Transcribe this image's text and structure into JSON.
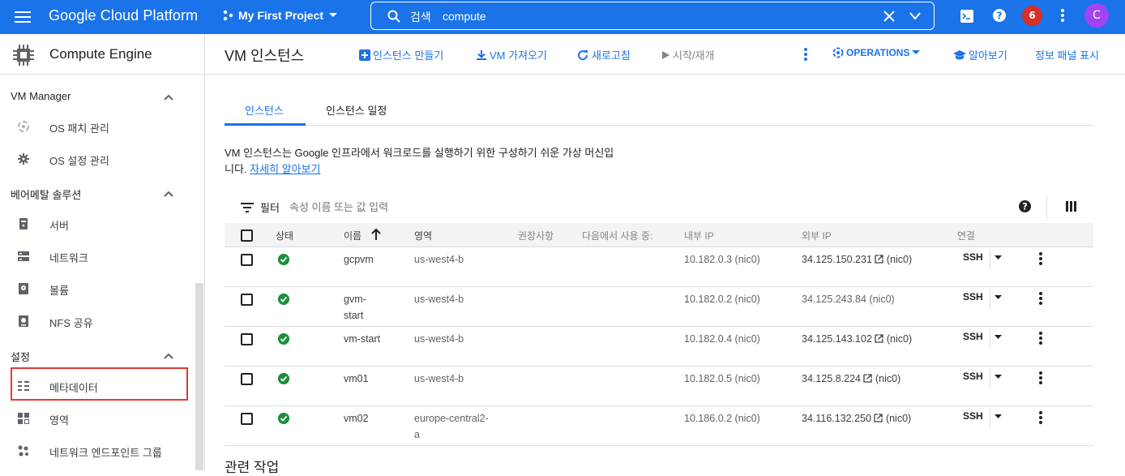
{
  "topbar": {
    "brand": "Google Cloud Platform",
    "project": "My First Project",
    "search_label": "검색",
    "search_value": "compute",
    "notification_count": "6",
    "avatar_letter": "C"
  },
  "sidebar": {
    "title": "Compute Engine",
    "sections": [
      {
        "label": "VM Manager",
        "items": [
          {
            "label": "OS 패치 관리"
          },
          {
            "label": "OS 설정 관리"
          }
        ]
      },
      {
        "label": "베어메탈 솔루션",
        "items": [
          {
            "label": "서버"
          },
          {
            "label": "네트워크"
          },
          {
            "label": "볼륨"
          },
          {
            "label": "NFS 공유"
          }
        ]
      },
      {
        "label": "설정",
        "items": [
          {
            "label": "메타데이터"
          },
          {
            "label": "영역"
          },
          {
            "label": "네트워크 엔드포인트 그룹"
          }
        ]
      }
    ]
  },
  "main": {
    "title": "VM 인스턴스",
    "actions": {
      "create": "인스턴스 만들기",
      "import": "VM 가져오기",
      "refresh": "새로고침",
      "start": "시작/재개",
      "operations": "OPERATIONS",
      "learn": "알아보기",
      "info_panel": "정보 패널 표시"
    },
    "tabs": [
      {
        "label": "인스턴스"
      },
      {
        "label": "인스턴스 일정"
      }
    ],
    "description_line1": "VM 인스턴스는 Google 인프라에서 워크로드를 실행하기 위한 구성하기 쉬운 가상 머신입",
    "description_line2": "니다. ",
    "description_link": "자세히 알아보기",
    "filter": {
      "label": "필터",
      "placeholder": "속성 이름 또는 값 입력"
    },
    "columns": {
      "status": "상태",
      "name": "이름",
      "zone": "영역",
      "recommendation": "권장사항",
      "in_use_by": "다음에서 사용 중:",
      "internal_ip": "내부 IP",
      "external_ip": "외부 IP",
      "connect": "연결"
    },
    "rows": [
      {
        "name_1": "gcpvm",
        "name_2": "",
        "zone_1": "us-west4-b",
        "zone_2": "",
        "internal_ip": "10.182.0.3 (nic0)",
        "external_ip": "34.125.150.231",
        "external_nic": "(nic0)",
        "connect": "SSH"
      },
      {
        "name_1": "gvm-",
        "name_2": "start",
        "zone_1": "us-west4-b",
        "zone_2": "",
        "internal_ip": "10.182.0.2 (nic0)",
        "external_ip": "34.125.243.84",
        "external_nic": "(nic0)",
        "connect": "SSH"
      },
      {
        "name_1": "vm-start",
        "name_2": "",
        "zone_1": "us-west4-b",
        "zone_2": "",
        "internal_ip": "10.182.0.4 (nic0)",
        "external_ip": "34.125.143.102",
        "external_nic": "(nic0)",
        "connect": "SSH"
      },
      {
        "name_1": "vm01",
        "name_2": "",
        "zone_1": "us-west4-b",
        "zone_2": "",
        "internal_ip": "10.182.0.5 (nic0)",
        "external_ip": "34.125.8.224",
        "external_nic": "(nic0)",
        "connect": "SSH"
      },
      {
        "name_1": "vm02",
        "name_2": "",
        "zone_1": "europe-central2-",
        "zone_2": "a",
        "internal_ip": "10.186.0.2 (nic0)",
        "external_ip": "34.116.132.250",
        "external_nic": "(nic0)",
        "connect": "SSH"
      }
    ],
    "related": "관련 작업"
  }
}
